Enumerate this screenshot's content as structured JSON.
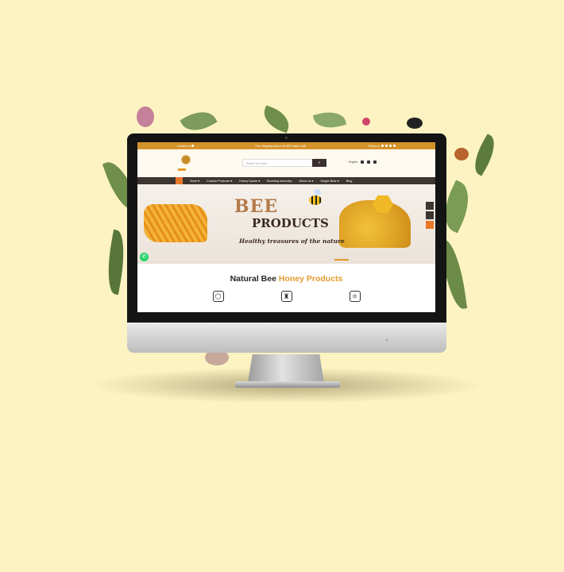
{
  "topbar": {
    "contact_label": "Contact us",
    "shipping_text": "Free Shipping Above 99 AED Inside UAE",
    "follow_label": "Follow us"
  },
  "header": {
    "search_placeholder": "Search our store",
    "language": "English"
  },
  "nav": {
    "items": [
      {
        "label": "Store ▾"
      },
      {
        "label": "Custom Products ▾"
      },
      {
        "label": "Honey Spoon ▾"
      },
      {
        "label": "Boosting Immunity"
      },
      {
        "label": "About us ▾"
      },
      {
        "label": "Ginger Bear ▾"
      },
      {
        "label": "Blog"
      }
    ]
  },
  "hero": {
    "title_line1": "BEE",
    "title_line2": "PRODUCTS",
    "subtitle": "Healthy treasures of the nature"
  },
  "section": {
    "title_plain": "Natural Bee ",
    "title_accent": "Honey Products"
  },
  "features": [
    {
      "icon": "honeycomb-icon"
    },
    {
      "icon": "jar-icon"
    },
    {
      "icon": "atom-icon"
    }
  ],
  "colors": {
    "background": "#fdf3c2",
    "accent": "#d4922a",
    "nav": "#3d3531"
  }
}
